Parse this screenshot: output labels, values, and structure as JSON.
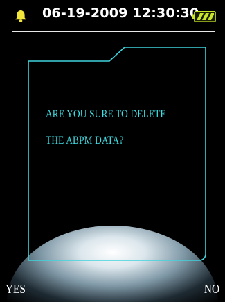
{
  "status_bar": {
    "datetime": "06-19-2009 12:30:30",
    "alarm_icon": "bell-icon",
    "battery_icon": "battery-icon",
    "bell_color": "#f2e63a",
    "battery_color": "#c8e62c"
  },
  "dialog": {
    "message_line1": "ARE YOU SURE TO DELETE",
    "message_line2": "THE ABPM DATA?",
    "border_color": "#3fd4dc"
  },
  "softkeys": {
    "left_label": "YES",
    "right_label": "NO"
  }
}
